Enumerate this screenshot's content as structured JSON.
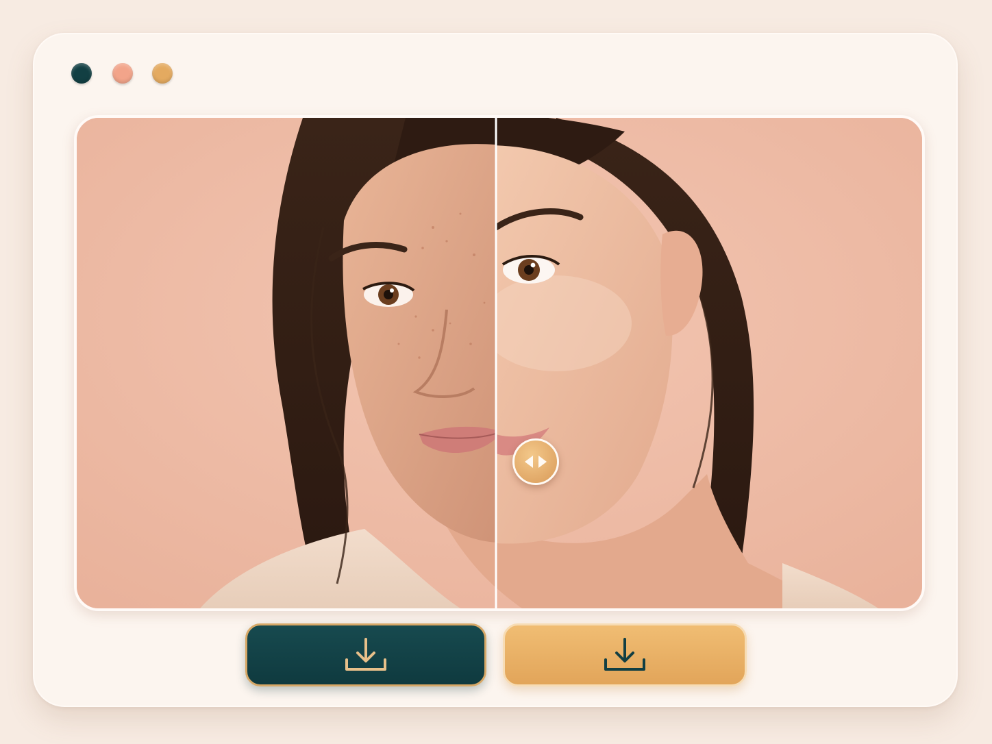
{
  "window": {
    "controls": [
      {
        "name": "dot-teal",
        "color": "#123f43"
      },
      {
        "name": "dot-coral",
        "color": "#f0a287"
      },
      {
        "name": "dot-gold",
        "color": "#e3a95e"
      }
    ]
  },
  "comparison": {
    "slider_position": 0.496,
    "left_image": "before-portrait-unretouched",
    "right_image": "after-portrait-retouched",
    "handle_icon": "left-right-arrows-icon"
  },
  "actions": {
    "download_before": {
      "icon": "download-icon",
      "color": "#123f43"
    },
    "download_after": {
      "icon": "download-icon",
      "color": "#e8ad63"
    }
  },
  "colors": {
    "background": "#f7ebe2",
    "window": "#fcf5ef",
    "photo_backdrop": "#efbca6",
    "accent_teal": "#123f43",
    "accent_gold": "#e3a95e"
  }
}
